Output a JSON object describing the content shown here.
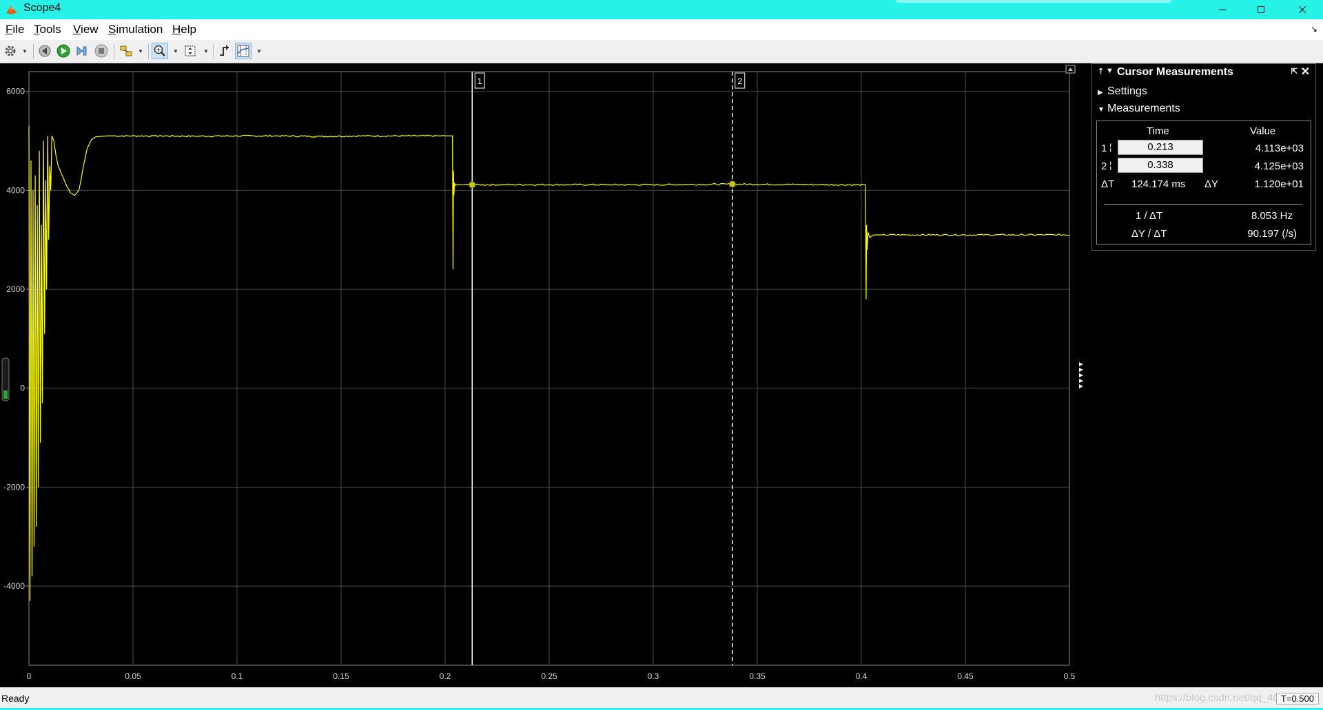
{
  "window": {
    "title": "Scope4",
    "minimize_icon": "minimize-icon",
    "maximize_icon": "maximize-icon",
    "close_icon": "close-icon"
  },
  "menu": {
    "items": [
      {
        "label": "File",
        "ul": "F",
        "rest": "ile"
      },
      {
        "label": "Tools",
        "ul": "T",
        "rest": "ools"
      },
      {
        "label": "View",
        "ul": "V",
        "rest": "iew"
      },
      {
        "label": "Simulation",
        "ul": "S",
        "rest": "imulation"
      },
      {
        "label": "Help",
        "ul": "H",
        "rest": "elp"
      }
    ]
  },
  "toolbar": {
    "icons": [
      "settings-icon",
      "step-back-icon",
      "run-icon",
      "step-forward-icon",
      "stop-icon",
      "highlight-icon",
      "zoom-in-icon",
      "fit-icon",
      "triggers-icon",
      "cursor-measurements-icon"
    ]
  },
  "chart_data": {
    "type": "line",
    "title": "",
    "xlabel": "",
    "ylabel": "",
    "xlim": [
      0,
      0.5
    ],
    "ylim": [
      -5600,
      6400
    ],
    "x_ticks": [
      "0",
      "0.05",
      "0.1",
      "0.15",
      "0.2",
      "0.25",
      "0.3",
      "0.35",
      "0.4",
      "0.45",
      "0.5"
    ],
    "y_ticks": [
      "6000",
      "4000",
      "2000",
      "0",
      "-2000",
      "-4000"
    ],
    "grid": true,
    "background": "#000000",
    "line_color": "#ffff00",
    "series": [
      {
        "x": [
          0,
          0.0005,
          0.001,
          0.0015,
          0.002,
          0.0025,
          0.003,
          0.0035,
          0.004,
          0.0045,
          0.005,
          0.0055,
          0.006,
          0.0065,
          0.007,
          0.0075,
          0.008,
          0.0085,
          0.009,
          0.0095,
          0.01,
          0.0105,
          0.011,
          0.012,
          0.013,
          0.014,
          0.016,
          0.018,
          0.02,
          0.022,
          0.024,
          0.025,
          0.026,
          0.027,
          0.028,
          0.03,
          0.032,
          0.034,
          0.036,
          0.038,
          0.04,
          0.06,
          0.08,
          0.1,
          0.12,
          0.14,
          0.16,
          0.18,
          0.2,
          0.2035,
          0.2038,
          0.204,
          0.2042,
          0.2045,
          0.205,
          0.206,
          0.208,
          0.213,
          0.25,
          0.3,
          0.338,
          0.38,
          0.402,
          0.4023,
          0.4025,
          0.4028,
          0.4032,
          0.404,
          0.406,
          0.41,
          0.45,
          0.5
        ],
        "y": [
          5300,
          -4300,
          4600,
          -3800,
          4000,
          -3200,
          4300,
          -2800,
          3700,
          -2000,
          4800,
          -1100,
          3300,
          -300,
          5000,
          1100,
          4200,
          2000,
          5100,
          3000,
          4500,
          4000,
          5100,
          5000,
          4700,
          4500,
          4300,
          4100,
          3950,
          3900,
          4000,
          4200,
          4450,
          4650,
          4850,
          5020,
          5080,
          5090,
          5095,
          5100,
          5100,
          5100,
          5095,
          5100,
          5100,
          5090,
          5100,
          5100,
          5100,
          5100,
          2400,
          4400,
          3900,
          4150,
          4100,
          4120,
          4113,
          4113,
          4115,
          4113,
          4125,
          4115,
          4110,
          1800,
          3300,
          2800,
          3150,
          3050,
          3100,
          3100,
          3100,
          3100
        ]
      }
    ],
    "cursors": [
      {
        "label": "1",
        "x": 0.213,
        "y": 4113,
        "style": "solid"
      },
      {
        "label": "2",
        "x": 0.338,
        "y": 4125,
        "style": "dashed"
      }
    ]
  },
  "cursor_panel": {
    "title": "Cursor Measurements",
    "settings_label": "Settings",
    "measurements_label": "Measurements",
    "col_time": "Time",
    "col_value": "Value",
    "row1_label": "1",
    "row1_time": "0.213",
    "row1_value": "4.113e+03",
    "row2_label": "2",
    "row2_time": "0.338",
    "row2_value": "4.125e+03",
    "dt_label": "ΔT",
    "dt_value": "124.174 ms",
    "dy_label": "ΔY",
    "dy_value": "1.120e+01",
    "inv_dt_label": "1 / ΔT",
    "inv_dt_value": "8.053 Hz",
    "slope_label": "ΔY / ΔT",
    "slope_value": "90.197 (/s)"
  },
  "status": {
    "text": "Ready",
    "time": "T=0.500",
    "watermark": "https://blog.csdn.net/qq_40"
  }
}
